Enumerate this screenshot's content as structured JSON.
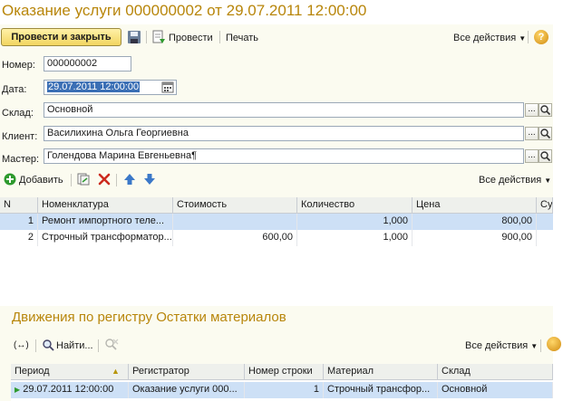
{
  "window": {
    "title": "Оказание услуги 000000002 от 29.07.2011 12:00:00"
  },
  "toolbar": {
    "post_close_label": "Провести и закрыть",
    "post_label": "Провести",
    "print_label": "Печать",
    "all_actions_label": "Все действия",
    "help_glyph": "?"
  },
  "form": {
    "number_label": "Номер:",
    "number_value": "000000002",
    "date_label": "Дата:",
    "date_value": "29.07.2011 12:00:00",
    "warehouse_label": "Склад:",
    "warehouse_value": "Основной",
    "client_label": "Клиент:",
    "client_value": "Василихина Ольга Георгиевна",
    "master_label": "Мастер:",
    "master_value": "Голендова Марина Евгеньевна¶",
    "ellipsis": "..."
  },
  "items_toolbar": {
    "add_label": "Добавить",
    "all_actions_label": "Все действия"
  },
  "items_table": {
    "columns": [
      "N",
      "Номенклатура",
      "Стоимость",
      "Количество",
      "Цена",
      "Су"
    ],
    "rows": [
      {
        "n": "1",
        "item": "Ремонт импортного теле...",
        "cost": "",
        "qty": "1,000",
        "price": "800,00"
      },
      {
        "n": "2",
        "item": "Строчный трансформатор...",
        "cost": "600,00",
        "qty": "1,000",
        "price": "900,00"
      }
    ]
  },
  "movements": {
    "title": "Движения  по регистру Остатки материалов",
    "find_label": "Найти...",
    "all_actions_label": "Все действия",
    "columns": [
      "Период",
      "Регистратор",
      "Номер строки",
      "Материал",
      "Склад"
    ],
    "rows": [
      {
        "period": "29.07.2011 12:00:00",
        "registrar": "Оказание услуги 000...",
        "line": "1",
        "material": "Строчный трансфор...",
        "warehouse": "Основной"
      }
    ]
  },
  "colors": {
    "title": "#b8860b",
    "selected_row": "#cde0f6",
    "primary_button": "#f2d560",
    "delete_icon": "#cc2a1e",
    "add_icon": "#2e9a2e",
    "arrow_icon": "#3b78c8"
  }
}
